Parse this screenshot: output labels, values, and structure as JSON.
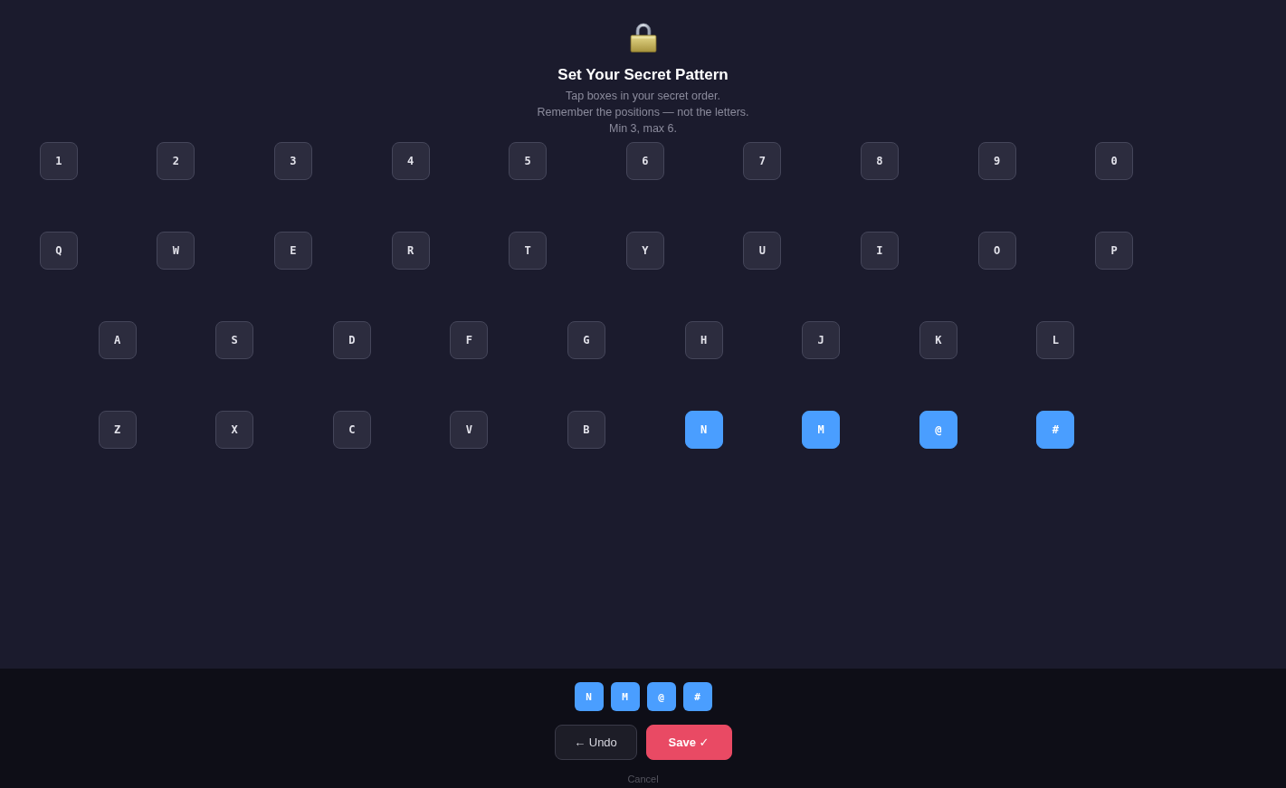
{
  "header": {
    "title": "Set Your Secret Pattern",
    "instructions": [
      "Tap boxes in your secret order.",
      "Remember the positions — not the letters.",
      "Min 3, max 6."
    ]
  },
  "keyboard": {
    "rows": [
      {
        "keys": [
          {
            "label": "1",
            "selected": false
          },
          {
            "label": "2",
            "selected": false
          },
          {
            "label": "3",
            "selected": false
          },
          {
            "label": "4",
            "selected": false
          },
          {
            "label": "5",
            "selected": false
          },
          {
            "label": "6",
            "selected": false
          },
          {
            "label": "7",
            "selected": false
          },
          {
            "label": "8",
            "selected": false
          },
          {
            "label": "9",
            "selected": false
          },
          {
            "label": "0",
            "selected": false
          }
        ]
      },
      {
        "keys": [
          {
            "label": "Q",
            "selected": false
          },
          {
            "label": "W",
            "selected": false
          },
          {
            "label": "E",
            "selected": false
          },
          {
            "label": "R",
            "selected": false
          },
          {
            "label": "T",
            "selected": false
          },
          {
            "label": "Y",
            "selected": false
          },
          {
            "label": "U",
            "selected": false
          },
          {
            "label": "I",
            "selected": false
          },
          {
            "label": "O",
            "selected": false
          },
          {
            "label": "P",
            "selected": false
          }
        ]
      },
      {
        "keys": [
          {
            "label": "A",
            "selected": false
          },
          {
            "label": "S",
            "selected": false
          },
          {
            "label": "D",
            "selected": false
          },
          {
            "label": "F",
            "selected": false
          },
          {
            "label": "G",
            "selected": false
          },
          {
            "label": "H",
            "selected": false
          },
          {
            "label": "J",
            "selected": false
          },
          {
            "label": "K",
            "selected": false
          },
          {
            "label": "L",
            "selected": false
          }
        ]
      },
      {
        "keys": [
          {
            "label": "Z",
            "selected": false
          },
          {
            "label": "X",
            "selected": false
          },
          {
            "label": "C",
            "selected": false
          },
          {
            "label": "V",
            "selected": false
          },
          {
            "label": "B",
            "selected": false
          },
          {
            "label": "N",
            "selected": true
          },
          {
            "label": "M",
            "selected": true
          },
          {
            "label": "@",
            "selected": true
          },
          {
            "label": "#",
            "selected": true
          }
        ]
      }
    ]
  },
  "pattern": {
    "chips": [
      "N",
      "M",
      "@",
      "#"
    ]
  },
  "actions": {
    "buttons": [
      {
        "kind": "secondary",
        "label": "← Undo"
      },
      {
        "kind": "primary",
        "label": "Save ✓"
      }
    ],
    "cancel": "Cancel"
  }
}
